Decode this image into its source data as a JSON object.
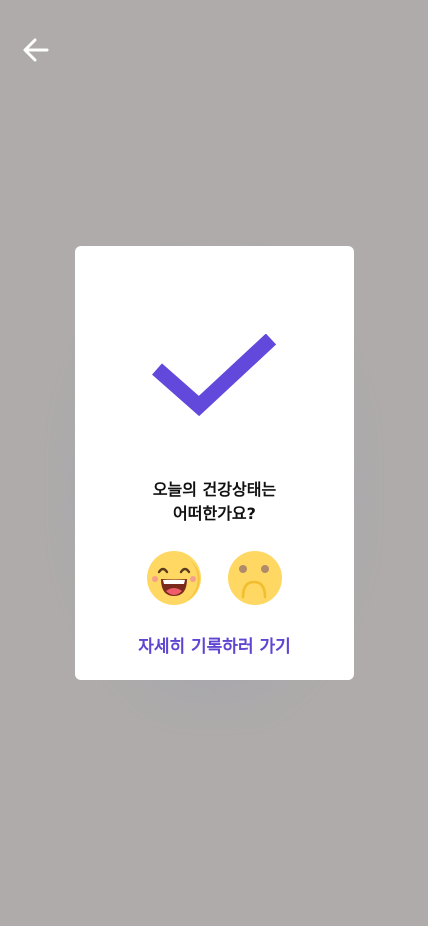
{
  "header": {
    "back_icon": "arrow-left-icon"
  },
  "dialog": {
    "question_line1": "오늘의 건강상태는",
    "question_line2": "어떠한가요?",
    "check_icon": "checkmark-icon",
    "options": [
      {
        "icon": "happy-face-icon"
      },
      {
        "icon": "sad-face-icon"
      }
    ],
    "record_link": "자세히 기록하러 가기"
  },
  "colors": {
    "background": "#aeabaa",
    "accent": "#5f45d2",
    "card": "#ffffff",
    "emoji_yellow": "#ffd863"
  }
}
